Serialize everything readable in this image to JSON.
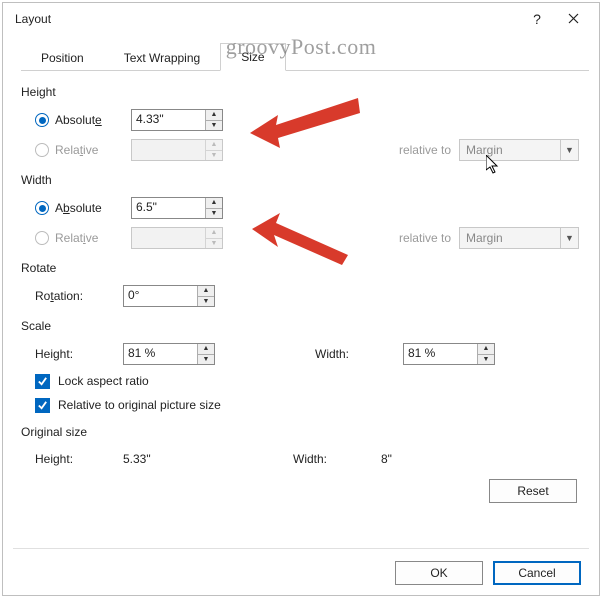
{
  "window": {
    "title": "Layout",
    "help": "?",
    "watermark": "groovyPost.com"
  },
  "tabs": {
    "position": "Position",
    "textwrap": "Text Wrapping",
    "size": "Size"
  },
  "height": {
    "section": "Height",
    "absolute_label_pre": "Absolut",
    "absolute_label_ul": "e",
    "absolute_value": "4.33\"",
    "relative_label_pre": "Rela",
    "relative_label_ul": "t",
    "relative_label_post": "ive",
    "relative_value": "",
    "relative_to": "relative to",
    "relative_to_value": "Margin"
  },
  "width": {
    "section": "Width",
    "absolute_label_pre": "A",
    "absolute_label_ul": "b",
    "absolute_label_post": "solute",
    "absolute_value": "6.5\"",
    "relative_label_pre": "Relat",
    "relative_label_ul": "i",
    "relative_label_post": "ve",
    "relative_value": "",
    "relative_to": "relative to",
    "relative_to_value": "Margin"
  },
  "rotate": {
    "section": "Rotate",
    "label_pre": "Ro",
    "label_ul": "t",
    "label_post": "ation:",
    "value": "0°"
  },
  "scale": {
    "section": "Scale",
    "height_label_ul": "H",
    "height_label_post": "eight:",
    "height_value": "81 %",
    "width_label_ul": "W",
    "width_label_post": "idth:",
    "width_value": "81 %",
    "lock_pre": "Lock ",
    "lock_ul": "a",
    "lock_post": "spect ratio",
    "rel_ul": "R",
    "rel_post": "elative to original picture size"
  },
  "original": {
    "section": "Original size",
    "height_label": "Height:",
    "height_value": "5.33\"",
    "width_label": "Width:",
    "width_value": "8\""
  },
  "buttons": {
    "reset": "Reset",
    "ok": "OK",
    "cancel": "Cancel"
  }
}
